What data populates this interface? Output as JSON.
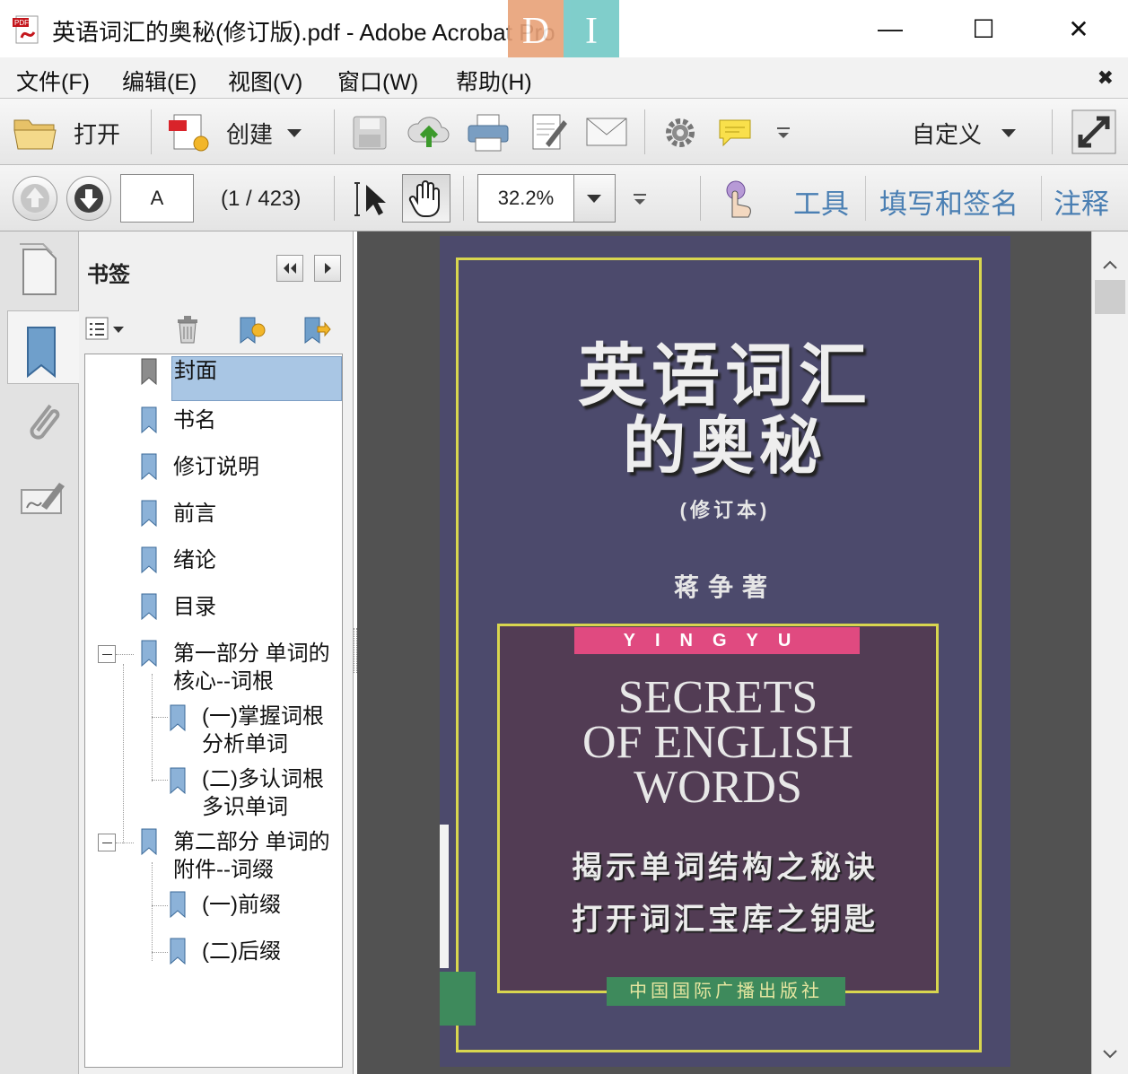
{
  "window": {
    "title": "英语词汇的奥秘(修订版).pdf - Adobe Acrobat Pro",
    "badge_left": "D",
    "badge_right": "I",
    "minimize": "—",
    "maximize": "☐",
    "close": "✕"
  },
  "menu": {
    "items": [
      "文件(F)",
      "编辑(E)",
      "视图(V)",
      "窗口(W)",
      "帮助(H)"
    ],
    "close_glyph": "✖"
  },
  "toolbar": {
    "open_label": "打开",
    "create_label": "创建",
    "customize_label": "自定义"
  },
  "navbar": {
    "page_value": "A",
    "page_count": "(1 / 423)",
    "zoom_value": "32.2%",
    "links": [
      "工具",
      "填写和签名",
      "注释"
    ]
  },
  "bookmarks": {
    "title": "书签",
    "items": [
      {
        "label": "封面",
        "selected": true
      },
      {
        "label": "书名"
      },
      {
        "label": "修订说明"
      },
      {
        "label": "前言"
      },
      {
        "label": "绪论"
      },
      {
        "label": "目录"
      },
      {
        "label_line1": "第一部分 单词的",
        "label_line2": "核心--词根"
      },
      {
        "label_line1": "(一)掌握词根",
        "label_line2": "分析单词"
      },
      {
        "label_line1": "(二)多认词根",
        "label_line2": "多识单词"
      },
      {
        "label_line1": "第二部分 单词的",
        "label_line2": "附件--词缀"
      },
      {
        "label": "(一)前缀"
      },
      {
        "label": "(二)后缀"
      }
    ]
  },
  "cover": {
    "title_line1": "英语词汇",
    "title_line2": "的奥秘",
    "edition": "(修订本)",
    "author": "蒋争著",
    "band": "YINGYU",
    "en_title": [
      "SECRETS",
      "OF  ENGLISH",
      "WORDS"
    ],
    "slogan1": "揭示单词结构之秘诀",
    "slogan2": "打开词汇宝库之钥匙",
    "publisher": "中国国际广播出版社"
  },
  "colors": {
    "link_blue": "#4a7fb3",
    "selection": "#a9c6e4",
    "cover_bg": "#4c4a6c",
    "frame_yellow": "#d8d64f",
    "band_pink": "#e04a80"
  }
}
